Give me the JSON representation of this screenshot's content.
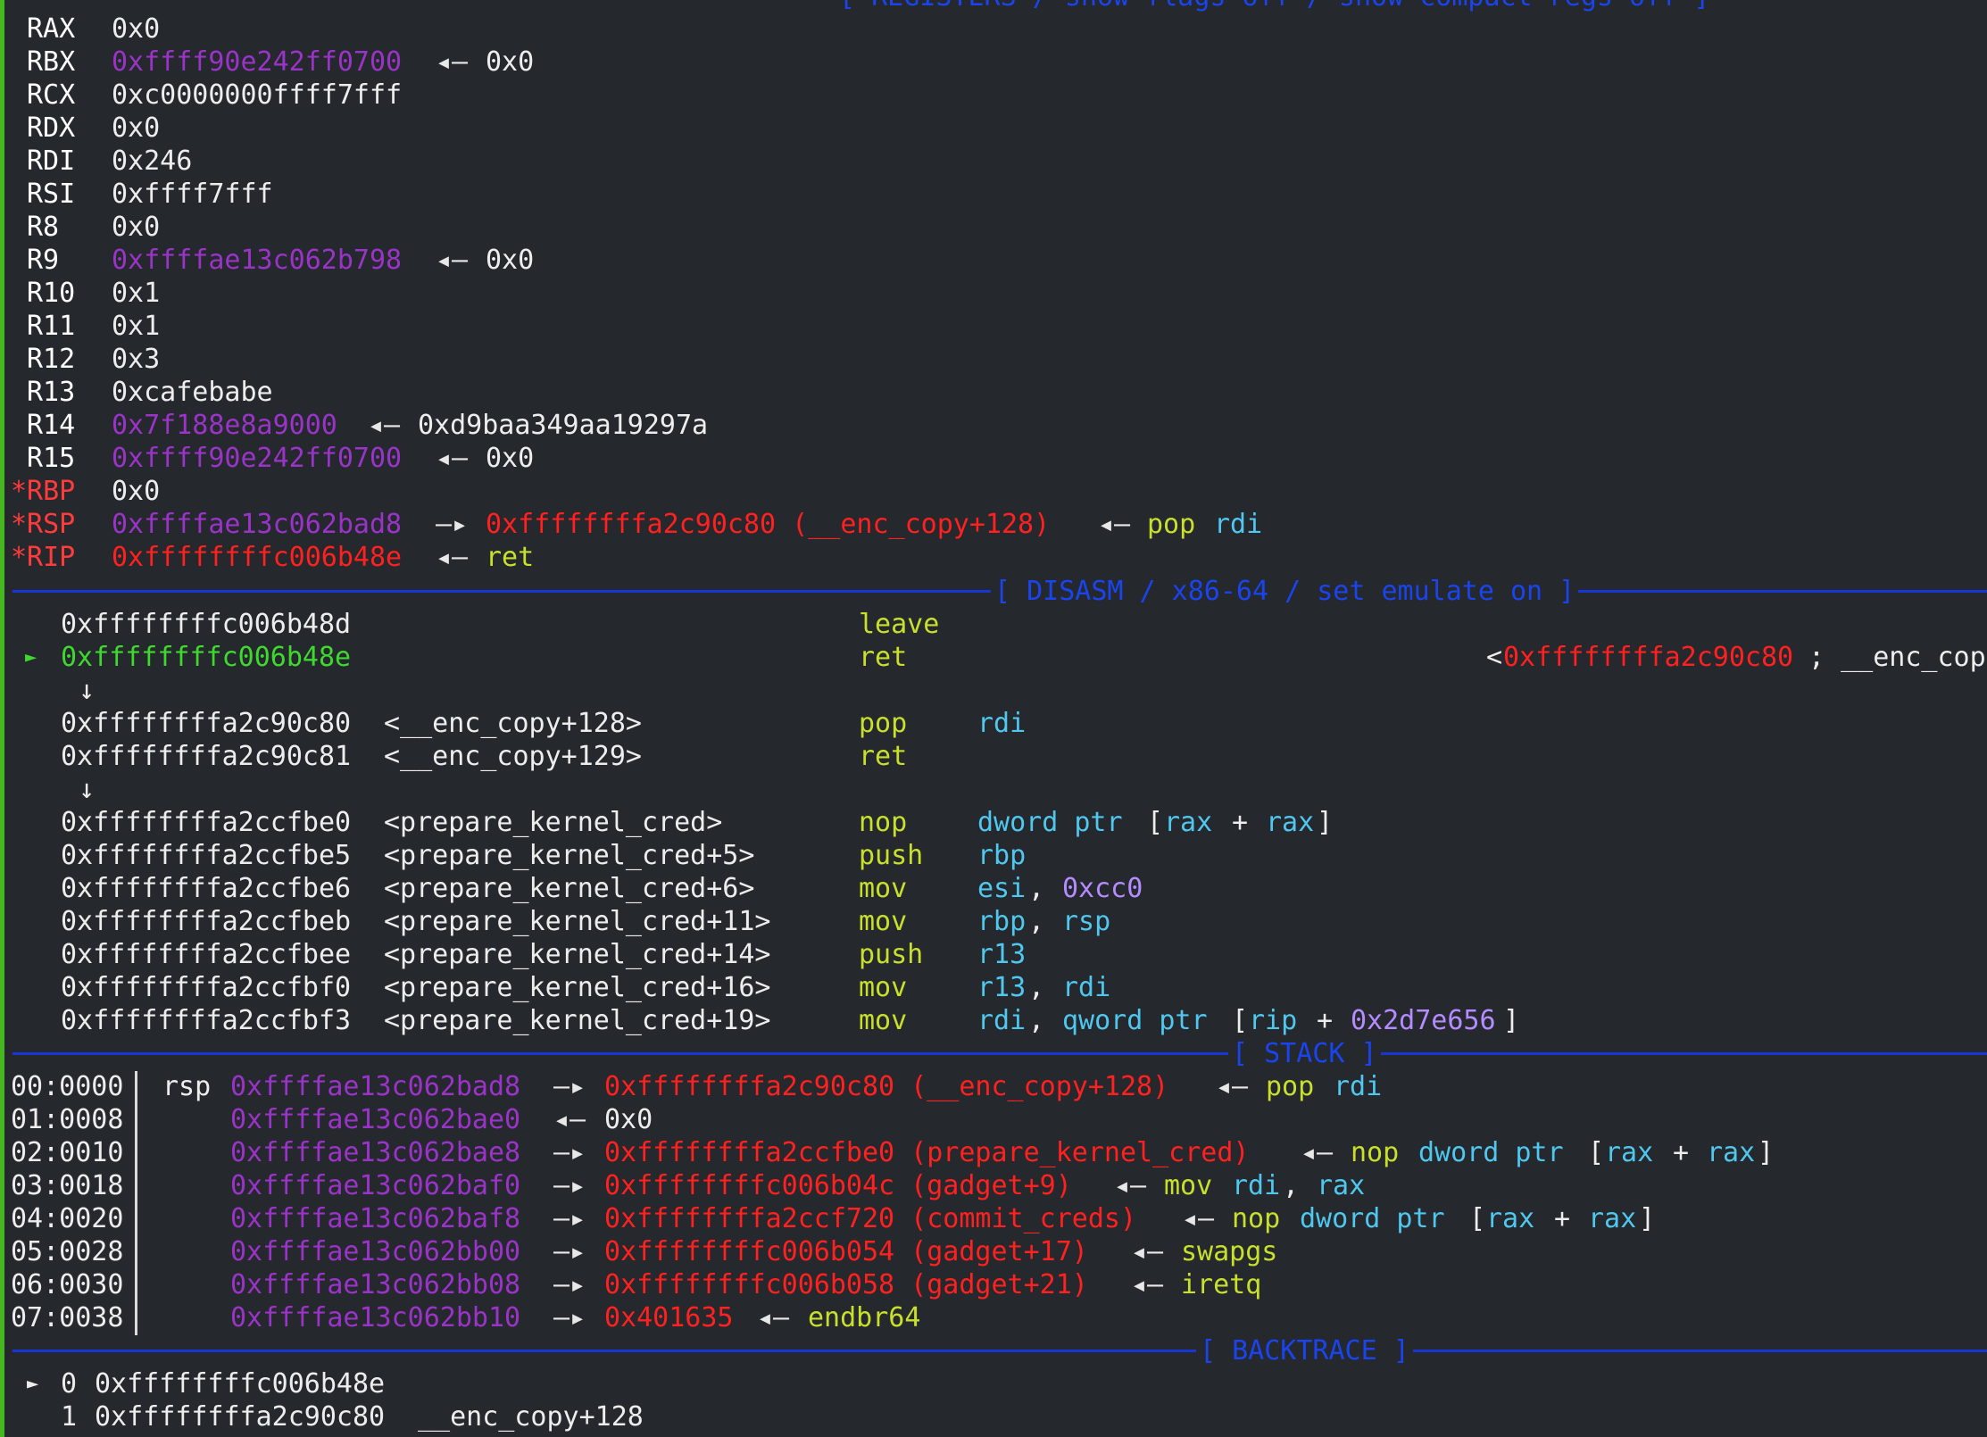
{
  "header_top": "[ REGISTERS / show-flags off / show-compact-regs off ]",
  "registers": [
    {
      "name": "RAX",
      "value": "0x0"
    },
    {
      "name": "RBX",
      "value": "0xffff90e242ff0700",
      "arrow": "◂—",
      "target": "0x0"
    },
    {
      "name": "RCX",
      "value": "0xc0000000ffff7fff"
    },
    {
      "name": "RDX",
      "value": "0x0"
    },
    {
      "name": "RDI",
      "value": "0x246"
    },
    {
      "name": "RSI",
      "value": "0xffff7fff"
    },
    {
      "name": "R8",
      "value": "0x0"
    },
    {
      "name": "R9",
      "value": "0xffffae13c062b798",
      "arrow": "◂—",
      "target": "0x0"
    },
    {
      "name": "R10",
      "value": "0x1"
    },
    {
      "name": "R11",
      "value": "0x1"
    },
    {
      "name": "R12",
      "value": "0x3"
    },
    {
      "name": "R13",
      "value": "0xcafebabe"
    },
    {
      "name": "R14",
      "value": "0x7f188e8a9000",
      "arrow": "◂—",
      "target": "0xd9baa349aa19297a"
    },
    {
      "name": "R15",
      "value": "0xffff90e242ff0700",
      "arrow": "◂—",
      "target": "0x0"
    },
    {
      "name": "*RBP",
      "value": "0x0"
    },
    {
      "name": "*RSP",
      "value": "0xffffae13c062bad8",
      "arrow": "—▸",
      "target": "0xffffffffa2c90c80 (__enc_copy+128)",
      "arrow2": "◂—",
      "instr_mn": "pop",
      "instr_op": "rdi"
    },
    {
      "name": "*RIP",
      "value": "0xffffffffc006b48e",
      "arrow": "◂—",
      "instr_mn": "ret"
    }
  ],
  "disasm_header": "[ DISASM / x86-64 / set emulate on ]",
  "disasm": {
    "line0": {
      "addr": "0xffffffffc006b48d",
      "mn": "leave"
    },
    "line1": {
      "marker": "►",
      "addr": "0xffffffffc006b48e",
      "mn": "ret",
      "target_open": "<",
      "target_addr": "0xffffffffa2c90c80",
      "target_rest": "; __enc_cop"
    },
    "down_arrow": "↓",
    "line2": {
      "addr": "0xffffffffa2c90c80",
      "sym": "<__enc_copy+128>",
      "mn": "pop",
      "ops": "rdi"
    },
    "line3": {
      "addr": "0xffffffffa2c90c81",
      "sym": "<__enc_copy+129>",
      "mn": "ret"
    },
    "line4": {
      "addr": "0xffffffffa2ccfbe0",
      "sym": "<prepare_kernel_cred>",
      "mn": "nop",
      "op1": "dword ptr",
      "op2": "[",
      "op3": "rax",
      "op4": "+",
      "op5": "rax",
      "op6": "]"
    },
    "line5": {
      "addr": "0xffffffffa2ccfbe5",
      "sym": "<prepare_kernel_cred+5>",
      "mn": "push",
      "ops": "rbp"
    },
    "line6": {
      "addr": "0xffffffffa2ccfbe6",
      "sym": "<prepare_kernel_cred+6>",
      "mn": "mov",
      "op1": "esi",
      "op2": ",",
      "op3": "0xcc0"
    },
    "line7": {
      "addr": "0xffffffffa2ccfbeb",
      "sym": "<prepare_kernel_cred+11>",
      "mn": "mov",
      "op1": "rbp",
      "op2": ",",
      "op3": "rsp"
    },
    "line8": {
      "addr": "0xffffffffa2ccfbee",
      "sym": "<prepare_kernel_cred+14>",
      "mn": "push",
      "ops": "r13"
    },
    "line9": {
      "addr": "0xffffffffa2ccfbf0",
      "sym": "<prepare_kernel_cred+16>",
      "mn": "mov",
      "op1": "r13",
      "op2": ",",
      "op3": "rdi"
    },
    "line10": {
      "addr": "0xffffffffa2ccfbf3",
      "sym": "<prepare_kernel_cred+19>",
      "mn": "mov",
      "op1": "rdi",
      "op2": ",",
      "op3": "qword ptr",
      "op4": "[",
      "op5": "rip",
      "op6": "+",
      "op7": "0x2d7e656",
      "op8": "]"
    }
  },
  "stack_header": "[ STACK ]",
  "stack": [
    {
      "idx": "00:0000",
      "reg": "rsp",
      "addr": "0xffffae13c062bad8",
      "arrow": "—▸",
      "target": "0xffffffffa2c90c80 (__enc_copy+128)",
      "arrow2": "◂—",
      "mn": "pop",
      "op1": "rdi"
    },
    {
      "idx": "01:0008",
      "addr": "0xffffae13c062bae0",
      "arrow": "◂—",
      "value": "0x0"
    },
    {
      "idx": "02:0010",
      "addr": "0xffffae13c062bae8",
      "arrow": "—▸",
      "target": "0xffffffffa2ccfbe0 (prepare_kernel_cred)",
      "arrow2": "◂—",
      "mn": "nop",
      "op1": "dword ptr",
      "op2": "[",
      "op3": "rax",
      "op4": "+",
      "op5": "rax",
      "op6": "]"
    },
    {
      "idx": "03:0018",
      "addr": "0xffffae13c062baf0",
      "arrow": "—▸",
      "target": "0xffffffffc006b04c (gadget+9)",
      "arrow2": "◂—",
      "mn": "mov",
      "op1": "rdi",
      "op2": ",",
      "op3": "rax"
    },
    {
      "idx": "04:0020",
      "addr": "0xffffae13c062baf8",
      "arrow": "—▸",
      "target": "0xffffffffa2ccf720 (commit_creds)",
      "arrow2": "◂—",
      "mn": "nop",
      "op1": "dword ptr",
      "op2": "[",
      "op3": "rax",
      "op4": "+",
      "op5": "rax",
      "op6": "]"
    },
    {
      "idx": "05:0028",
      "addr": "0xffffae13c062bb00",
      "arrow": "—▸",
      "target": "0xffffffffc006b054 (gadget+17)",
      "arrow2": "◂—",
      "mn": "swapgs"
    },
    {
      "idx": "06:0030",
      "addr": "0xffffae13c062bb08",
      "arrow": "—▸",
      "target": "0xffffffffc006b058 (gadget+21)",
      "arrow2": "◂—",
      "mn": "iretq"
    },
    {
      "idx": "07:0038",
      "addr": "0xffffae13c062bb10",
      "arrow": "—▸",
      "target": "0x401635",
      "arrow2": "◂—",
      "mn": "endbr64"
    }
  ],
  "backtrace_header": "[ BACKTRACE ]",
  "backtrace": [
    {
      "marker": "►",
      "num": "0",
      "addr": "0xffffffffc006b48e"
    },
    {
      "num": "1",
      "addr": "0xffffffffa2c90c80",
      "sym": "__enc_copy+128"
    }
  ],
  "colors": {
    "background": "#25282c",
    "pointer": "#9a33c8",
    "code": "#ff2020",
    "mnemonic": "#c8e02c",
    "operand": "#4fc7ef",
    "immediate": "#b48cff",
    "current": "#3fd82f",
    "header": "#1a44ee",
    "modified_reg": "#ff3b3b"
  }
}
